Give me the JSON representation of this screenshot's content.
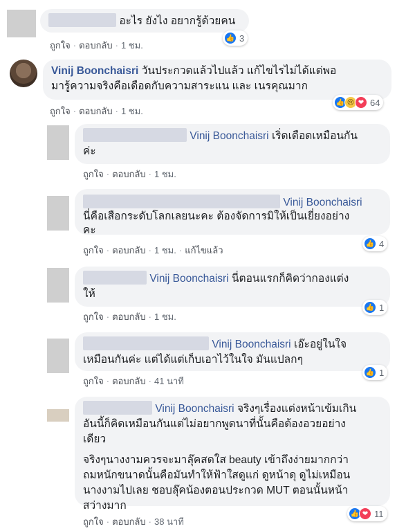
{
  "comments": [
    {
      "text": "อะไร ยังไง อยากรู้ด้วยคน",
      "actions": {
        "like": "ถูกใจ",
        "reply": "ตอบกลับ",
        "time": "1 ชม."
      },
      "reactions": {
        "icons": [
          "like-icon"
        ],
        "count": "3"
      }
    },
    {
      "author": "Vinij Boonchaisri",
      "text": "วันประกวดแล้วไปแล้ว แก้ไขไรไม่ได้แต่พอมารู้ความจริงคือเดือดกับความสาระแน และ เนรคุณมาก",
      "line1": "วันประกวดแล้วไปแล้ว แก้ไขไรไม่ได้แต่พอ",
      "line2": "มารู้ความจริงคือเดือดกับความสาระแน และ เนรคุณมาก",
      "actions": {
        "like": "ถูกใจ",
        "reply": "ตอบกลับ",
        "time": "1 ชม."
      },
      "reactions": {
        "icons": [
          "like-icon",
          "sad-icon",
          "love-icon"
        ],
        "count": "64"
      }
    }
  ],
  "replies": [
    {
      "mention": "Vinij Boonchaisri",
      "line1": "เริ่ดเดือดเหมือนกัน",
      "line2": "ค่ะ",
      "actions": {
        "like": "ถูกใจ",
        "reply": "ตอบกลับ",
        "time": "1 ชม."
      }
    },
    {
      "mention": "Vinij Boonchaisri",
      "line1": "นี่คือเสือกระดับโลกเลยนะคะ ต้องจัดการมิให้เป็นเยี่ยงอย่าง",
      "line2": "คะ",
      "actions": {
        "like": "ถูกใจ",
        "reply": "ตอบกลับ",
        "time": "1 ชม.",
        "edited": "แก้ไขแล้ว"
      },
      "reactions": {
        "count": "4"
      }
    },
    {
      "mention": "Vinij Boonchaisri",
      "line1": "นี่ตอนแรกก็คิดว่ากองแต่ง",
      "line2": "ให้",
      "actions": {
        "like": "ถูกใจ",
        "reply": "ตอบกลับ",
        "time": "1 ชม."
      },
      "reactions": {
        "count": "1"
      }
    },
    {
      "mention": "Vinij Boonchaisri",
      "line1": "เอ๊ะอยู่ในใจ",
      "line2": "เหมือนกันค่ะ แต่ได้แต่เก็บเอาไว้ในใจ มันแปลกๆ",
      "actions": {
        "like": "ถูกใจ",
        "reply": "ตอบกลับ",
        "time": "41 นาที"
      },
      "reactions": {
        "count": "1"
      }
    },
    {
      "mention": "Vinij Boonchaisri",
      "line1": "จริงๆเรื่องแต่งหน้าเข้มเกิน",
      "line2": "อันนี้ก็คิดเหมือนกันแต่ไม่อยากพูดนาที่นั้นคือต้องอวยอย่าง",
      "line3": "เดียว",
      "para2_line1": "จริงๆนางงามควรจะมาลุ๊คสดใส beauty เข้าถึงง่ายมากกว่า",
      "para2_line2": "ถมหนักขนาดนั้นคือมันทำให้ฟ้าใสดูแก่ ดูหน้าดุ ดูไม่เหมือน",
      "para2_line3": "นางงามไปเลย ชอบลุ๊คน้องตอนประกวด MUT ตอนนั้นหน้า",
      "para2_line4": "สว่างมาก",
      "actions": {
        "like": "ถูกใจ",
        "reply": "ตอบกลับ",
        "time": "38 นาที"
      },
      "reactions": {
        "icons": [
          "like-icon",
          "love-icon"
        ],
        "count": "11"
      }
    }
  ]
}
